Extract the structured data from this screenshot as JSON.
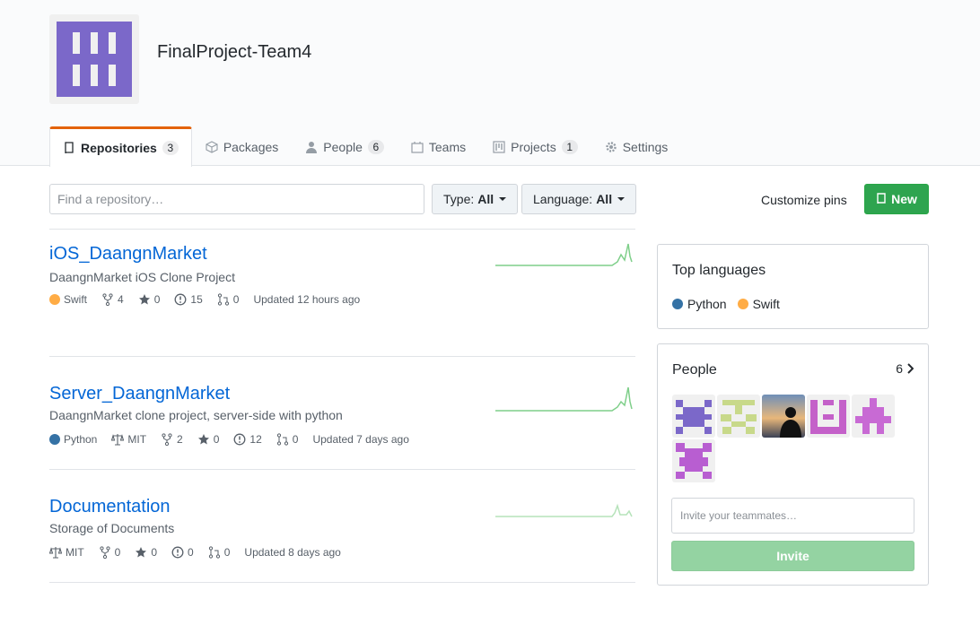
{
  "org": {
    "name": "FinalProject-Team4",
    "avatar_color": "#7b68c9"
  },
  "tabs": [
    {
      "label": "Repositories",
      "count": "3",
      "icon": "repo-icon"
    },
    {
      "label": "Packages",
      "icon": "package-icon"
    },
    {
      "label": "People",
      "count": "6",
      "icon": "person-icon"
    },
    {
      "label": "Teams",
      "icon": "teams-icon"
    },
    {
      "label": "Projects",
      "count": "1",
      "icon": "project-icon"
    },
    {
      "label": "Settings",
      "icon": "gear-icon"
    }
  ],
  "toolbar": {
    "search_placeholder": "Find a repository…",
    "type_label": "Type:",
    "type_value": "All",
    "language_label": "Language:",
    "language_value": "All",
    "customize_label": "Customize pins",
    "new_label": "New"
  },
  "repos": [
    {
      "name": "iOS_DaangnMarket",
      "description": "DaangnMarket iOS Clone Project",
      "language": "Swift",
      "language_color": "#ffac45",
      "license": "",
      "forks": "4",
      "stars": "0",
      "issues": "15",
      "prs": "0",
      "updated": "Updated 12 hours ago"
    },
    {
      "name": "Server_DaangnMarket",
      "description": "DaangnMarket clone project, server-side with python",
      "language": "Python",
      "language_color": "#3572a5",
      "license": "MIT",
      "forks": "2",
      "stars": "0",
      "issues": "12",
      "prs": "0",
      "updated": "Updated 7 days ago"
    },
    {
      "name": "Documentation",
      "description": "Storage of Documents",
      "language": "",
      "language_color": "",
      "license": "MIT",
      "forks": "0",
      "stars": "0",
      "issues": "0",
      "prs": "0",
      "updated": "Updated 8 days ago"
    }
  ],
  "top_languages": {
    "title": "Top languages",
    "items": [
      {
        "name": "Python",
        "color": "#3572a5"
      },
      {
        "name": "Swift",
        "color": "#ffac45"
      }
    ]
  },
  "people": {
    "title": "People",
    "count": "6",
    "invite_placeholder": "Invite your teammates…",
    "invite_label": "Invite",
    "avatar_colors": [
      "#7b68c9",
      "#c8d98a",
      "#2b3a55",
      "#c461c9",
      "#c86ad4",
      "#b85ed1"
    ]
  }
}
